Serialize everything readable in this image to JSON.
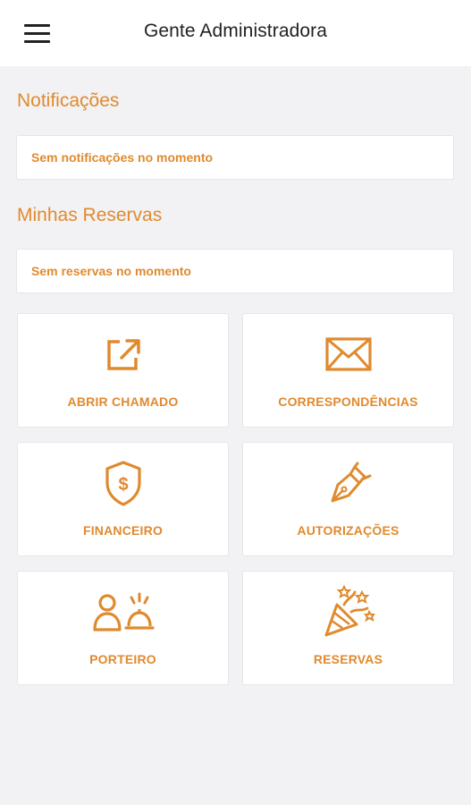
{
  "colors": {
    "accent": "#e08a2e",
    "background": "#f2f2f4",
    "appbar": "#ffffff",
    "title_text": "#222222"
  },
  "appbar": {
    "title": "Gente Administradora",
    "menu_icon": "hamburger-menu-icon"
  },
  "notifications": {
    "title": "Notificações",
    "message": "Sem notificações no momento"
  },
  "reservations": {
    "title": "Minhas Reservas",
    "message": "Sem reservas no momento"
  },
  "tiles": [
    {
      "label": "ABRIR CHAMADO",
      "icon": "external-link-icon"
    },
    {
      "label": "CORRESPONDÊNCIAS",
      "icon": "envelope-icon"
    },
    {
      "label": "FINANCEIRO",
      "icon": "shield-dollar-icon"
    },
    {
      "label": "AUTORIZAÇÕES",
      "icon": "fountain-pen-icon"
    },
    {
      "label": "PORTEIRO",
      "icon": "concierge-icon"
    },
    {
      "label": "RESERVAS",
      "icon": "party-popper-icon"
    }
  ]
}
